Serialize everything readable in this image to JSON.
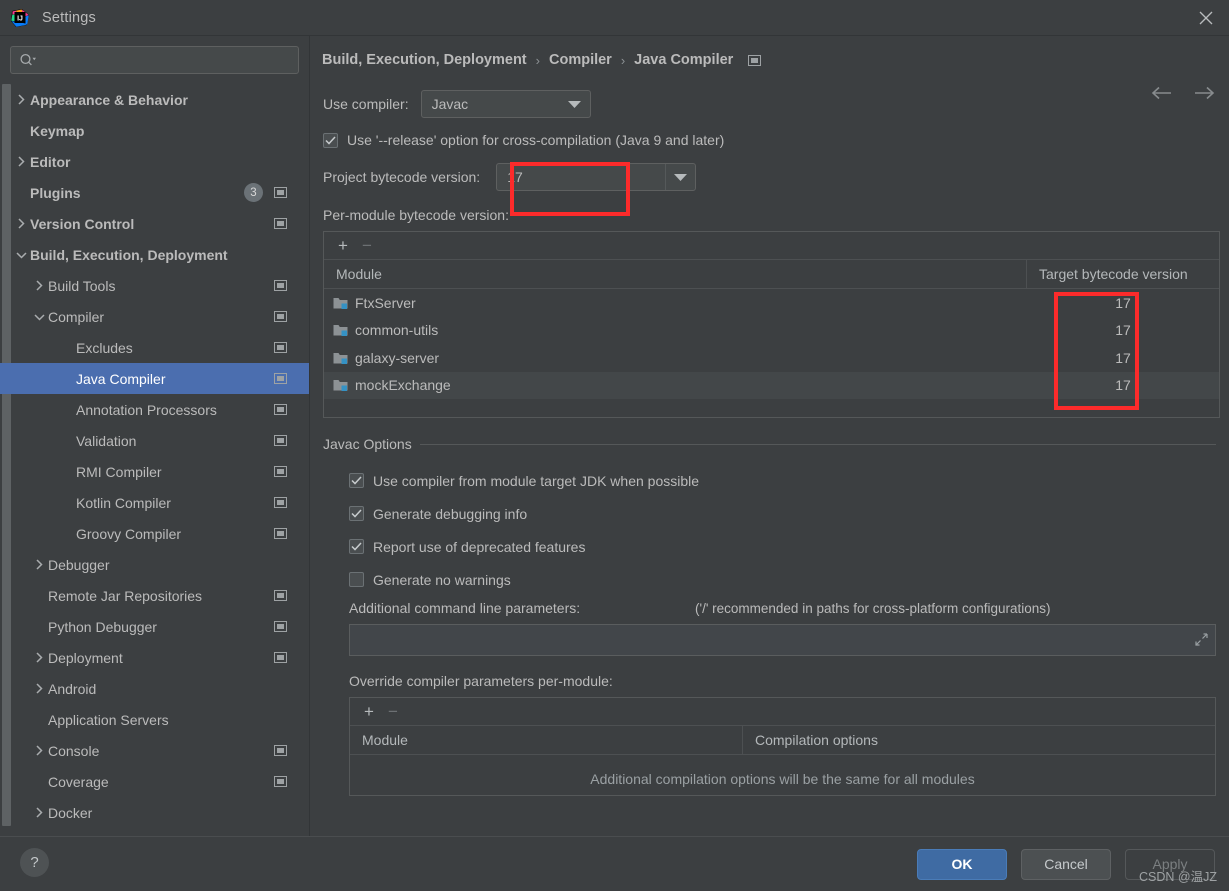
{
  "window": {
    "title": "Settings",
    "logo_icon": "intellij-idea-logo",
    "close_icon": "close-icon"
  },
  "search": {
    "placeholder": "",
    "value": "",
    "icon": "search-icon"
  },
  "sidebar": {
    "items": [
      {
        "label": "Appearance & Behavior",
        "depth": 0,
        "arrow": "chevron-right",
        "bold": true,
        "scope": false,
        "badge": ""
      },
      {
        "label": "Keymap",
        "depth": 0,
        "arrow": "none",
        "bold": true,
        "scope": false,
        "badge": ""
      },
      {
        "label": "Editor",
        "depth": 0,
        "arrow": "chevron-right",
        "bold": true,
        "scope": false,
        "badge": ""
      },
      {
        "label": "Plugins",
        "depth": 0,
        "arrow": "none",
        "bold": true,
        "scope": true,
        "badge": "3"
      },
      {
        "label": "Version Control",
        "depth": 0,
        "arrow": "chevron-right",
        "bold": true,
        "scope": true,
        "badge": ""
      },
      {
        "label": "Build, Execution, Deployment",
        "depth": 0,
        "arrow": "chevron-down",
        "bold": true,
        "scope": false,
        "badge": ""
      },
      {
        "label": "Build Tools",
        "depth": 1,
        "arrow": "chevron-right",
        "bold": false,
        "scope": true,
        "badge": ""
      },
      {
        "label": "Compiler",
        "depth": 1,
        "arrow": "chevron-down",
        "bold": false,
        "scope": true,
        "badge": ""
      },
      {
        "label": "Excludes",
        "depth": 2,
        "arrow": "none",
        "bold": false,
        "scope": true,
        "badge": ""
      },
      {
        "label": "Java Compiler",
        "depth": 2,
        "arrow": "none",
        "bold": false,
        "scope": true,
        "badge": "",
        "selected": true
      },
      {
        "label": "Annotation Processors",
        "depth": 2,
        "arrow": "none",
        "bold": false,
        "scope": true,
        "badge": ""
      },
      {
        "label": "Validation",
        "depth": 2,
        "arrow": "none",
        "bold": false,
        "scope": true,
        "badge": ""
      },
      {
        "label": "RMI Compiler",
        "depth": 2,
        "arrow": "none",
        "bold": false,
        "scope": true,
        "badge": ""
      },
      {
        "label": "Kotlin Compiler",
        "depth": 2,
        "arrow": "none",
        "bold": false,
        "scope": true,
        "badge": ""
      },
      {
        "label": "Groovy Compiler",
        "depth": 2,
        "arrow": "none",
        "bold": false,
        "scope": true,
        "badge": ""
      },
      {
        "label": "Debugger",
        "depth": 1,
        "arrow": "chevron-right",
        "bold": false,
        "scope": false,
        "badge": ""
      },
      {
        "label": "Remote Jar Repositories",
        "depth": 1,
        "arrow": "none",
        "bold": false,
        "scope": true,
        "badge": ""
      },
      {
        "label": "Python Debugger",
        "depth": 1,
        "arrow": "none",
        "bold": false,
        "scope": true,
        "badge": ""
      },
      {
        "label": "Deployment",
        "depth": 1,
        "arrow": "chevron-right",
        "bold": false,
        "scope": true,
        "badge": ""
      },
      {
        "label": "Android",
        "depth": 1,
        "arrow": "chevron-right",
        "bold": false,
        "scope": false,
        "badge": ""
      },
      {
        "label": "Application Servers",
        "depth": 1,
        "arrow": "none",
        "bold": false,
        "scope": false,
        "badge": ""
      },
      {
        "label": "Console",
        "depth": 1,
        "arrow": "chevron-right",
        "bold": false,
        "scope": true,
        "badge": ""
      },
      {
        "label": "Coverage",
        "depth": 1,
        "arrow": "none",
        "bold": false,
        "scope": true,
        "badge": ""
      },
      {
        "label": "Docker",
        "depth": 1,
        "arrow": "chevron-right",
        "bold": false,
        "scope": false,
        "badge": ""
      }
    ]
  },
  "main": {
    "breadcrumb": {
      "part1": "Build, Execution, Deployment",
      "sep1": "›",
      "part2": "Compiler",
      "sep2": "›",
      "part3": "Java Compiler",
      "scope_icon": "project-scope-icon"
    },
    "nav": {
      "back_icon": "arrow-left-icon",
      "forward_icon": "arrow-right-icon"
    },
    "use_compiler": {
      "label": "Use compiler:",
      "value": "Javac"
    },
    "release_option": {
      "label": "Use '--release' option for cross-compilation (Java 9 and later)",
      "checked": true
    },
    "project_bytecode": {
      "label": "Project bytecode version:",
      "value": "17"
    },
    "per_module": {
      "label": "Per-module bytecode version:",
      "add_label": "+",
      "remove_label": "−",
      "columns": [
        "Module",
        "Target bytecode version"
      ],
      "rows": [
        {
          "module": "FtxServer",
          "target": "17"
        },
        {
          "module": "common-utils",
          "target": "17"
        },
        {
          "module": "galaxy-server",
          "target": "17"
        },
        {
          "module": "mockExchange",
          "target": "17"
        }
      ]
    },
    "javac_options": {
      "title": "Javac Options",
      "checkboxes": [
        {
          "label": "Use compiler from module target JDK when possible",
          "checked": true
        },
        {
          "label": "Generate debugging info",
          "checked": true
        },
        {
          "label": "Report use of deprecated features",
          "checked": true
        },
        {
          "label": "Generate no warnings",
          "checked": false
        }
      ],
      "additional_params_label": "Additional command line parameters:",
      "additional_params_hint": "('/' recommended in paths for cross-platform configurations)",
      "additional_params_value": "",
      "override_label": "Override compiler parameters per-module:",
      "override_add_label": "+",
      "override_remove_label": "−",
      "override_columns": [
        "Module",
        "Compilation options"
      ],
      "override_empty_message": "Additional compilation options will be the same for all modules"
    }
  },
  "footer": {
    "help_label": "?",
    "ok_label": "OK",
    "cancel_label": "Cancel",
    "apply_label": "Apply",
    "watermark": "CSDN @温JZ"
  },
  "colors": {
    "background": "#3c3f41",
    "selection": "#4b6eaf",
    "highlight": "#fc2b2b",
    "primary_button": "#3f6ba3",
    "text": "#bbbbbb"
  }
}
